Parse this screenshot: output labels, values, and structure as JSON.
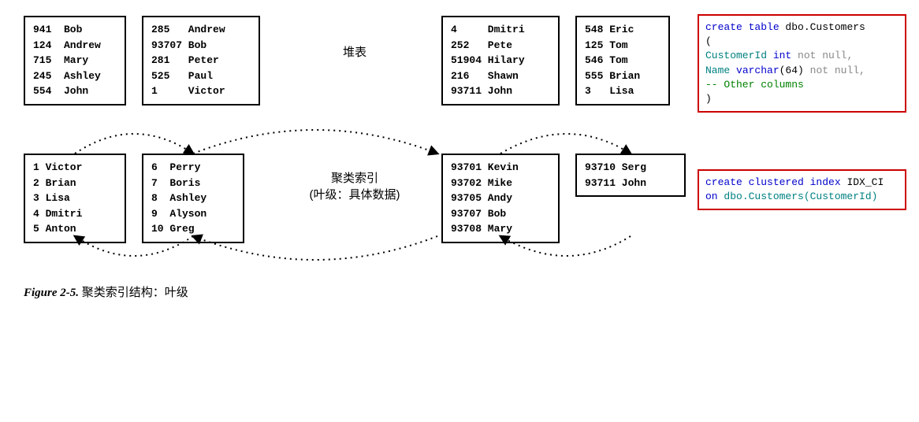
{
  "heap": {
    "label": "堆表",
    "boxes": [
      {
        "rows": [
          "941  Bob",
          "124  Andrew",
          "715  Mary",
          "245  Ashley",
          "554  John"
        ]
      },
      {
        "rows": [
          "285   Andrew",
          "93707 Bob",
          "281   Peter",
          "525   Paul",
          "1     Victor"
        ]
      },
      {
        "rows": [
          "4     Dmitri",
          "252   Pete",
          "51904 Hilary",
          "216   Shawn",
          "93711 John"
        ]
      },
      {
        "rows": [
          "548 Eric",
          "125 Tom",
          "546 Tom",
          "555 Brian",
          "3   Lisa"
        ]
      }
    ]
  },
  "clustered": {
    "label_line1": "聚类索引",
    "label_line2": "(叶级：具体数据)",
    "boxes": [
      {
        "rows": [
          "1 Victor",
          "2 Brian",
          "3 Lisa",
          "4 Dmitri",
          "5 Anton"
        ]
      },
      {
        "rows": [
          "6  Perry",
          "7  Boris",
          "8  Ashley",
          "9  Alyson",
          "10 Greg"
        ]
      },
      {
        "rows": [
          "93701 Kevin",
          "93702 Mike",
          "93705 Andy",
          "93707 Bob",
          "93708 Mary"
        ]
      },
      {
        "rows": [
          "93710 Serg",
          "93711 John"
        ]
      }
    ]
  },
  "code_create_table": {
    "l1a": "create table",
    "l1b": " dbo.Customers",
    "l2": "(",
    "l3a": "    CustomerId ",
    "l3b": "int",
    "l3c": " not null,",
    "l4a": "    Name ",
    "l4b": "varchar",
    "l4c": "(64) ",
    "l4d": "not null,",
    "l5": "    -- Other columns",
    "l6": ")"
  },
  "code_create_index": {
    "l1a": "create clustered index",
    "l1b": " IDX_CI",
    "l2a": "on",
    "l2b": " dbo.Customers(CustomerId)"
  },
  "caption": {
    "bold": "Figure 2-5.",
    "rest": "  聚类索引结构：叶级"
  }
}
